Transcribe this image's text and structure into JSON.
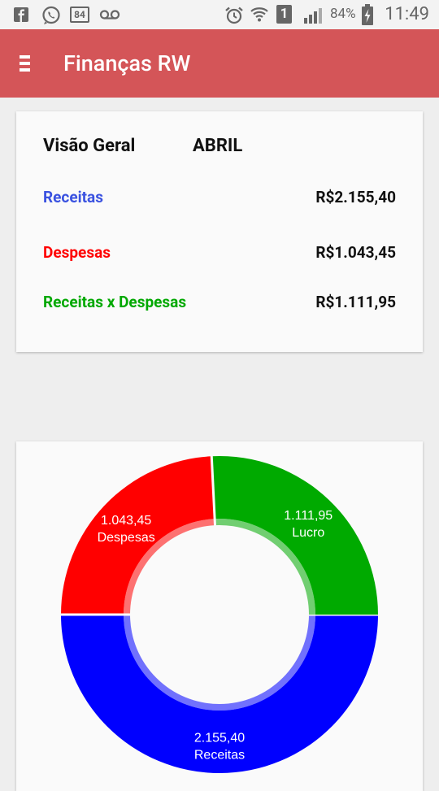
{
  "status_bar": {
    "notification_count": "84",
    "sim_label": "1",
    "battery_percent": "84%",
    "time": "11:49"
  },
  "app_bar": {
    "title": "Finanças RW"
  },
  "overview": {
    "title": "Visão Geral",
    "month": "ABRIL",
    "rows": [
      {
        "label": "Receitas",
        "value": "R$2.155,40",
        "color": "#3a52e0"
      },
      {
        "label": "Despesas",
        "value": "R$1.043,45",
        "color": "#ff0000"
      },
      {
        "label": "Receitas x Despesas",
        "value": "R$1.111,95",
        "color": "#00a800"
      }
    ]
  },
  "chart_data": {
    "type": "pie",
    "style": "donut",
    "segments": [
      {
        "value": 2155.4,
        "value_label": "2.155,40",
        "label": "Receitas",
        "color": "#0000ff"
      },
      {
        "value": 1043.45,
        "value_label": "1.043,45",
        "label": "Despesas",
        "color": "#ff0000"
      },
      {
        "value": 1111.95,
        "value_label": "1.111,95",
        "label": "Lucro",
        "color": "#00aa00"
      }
    ]
  }
}
